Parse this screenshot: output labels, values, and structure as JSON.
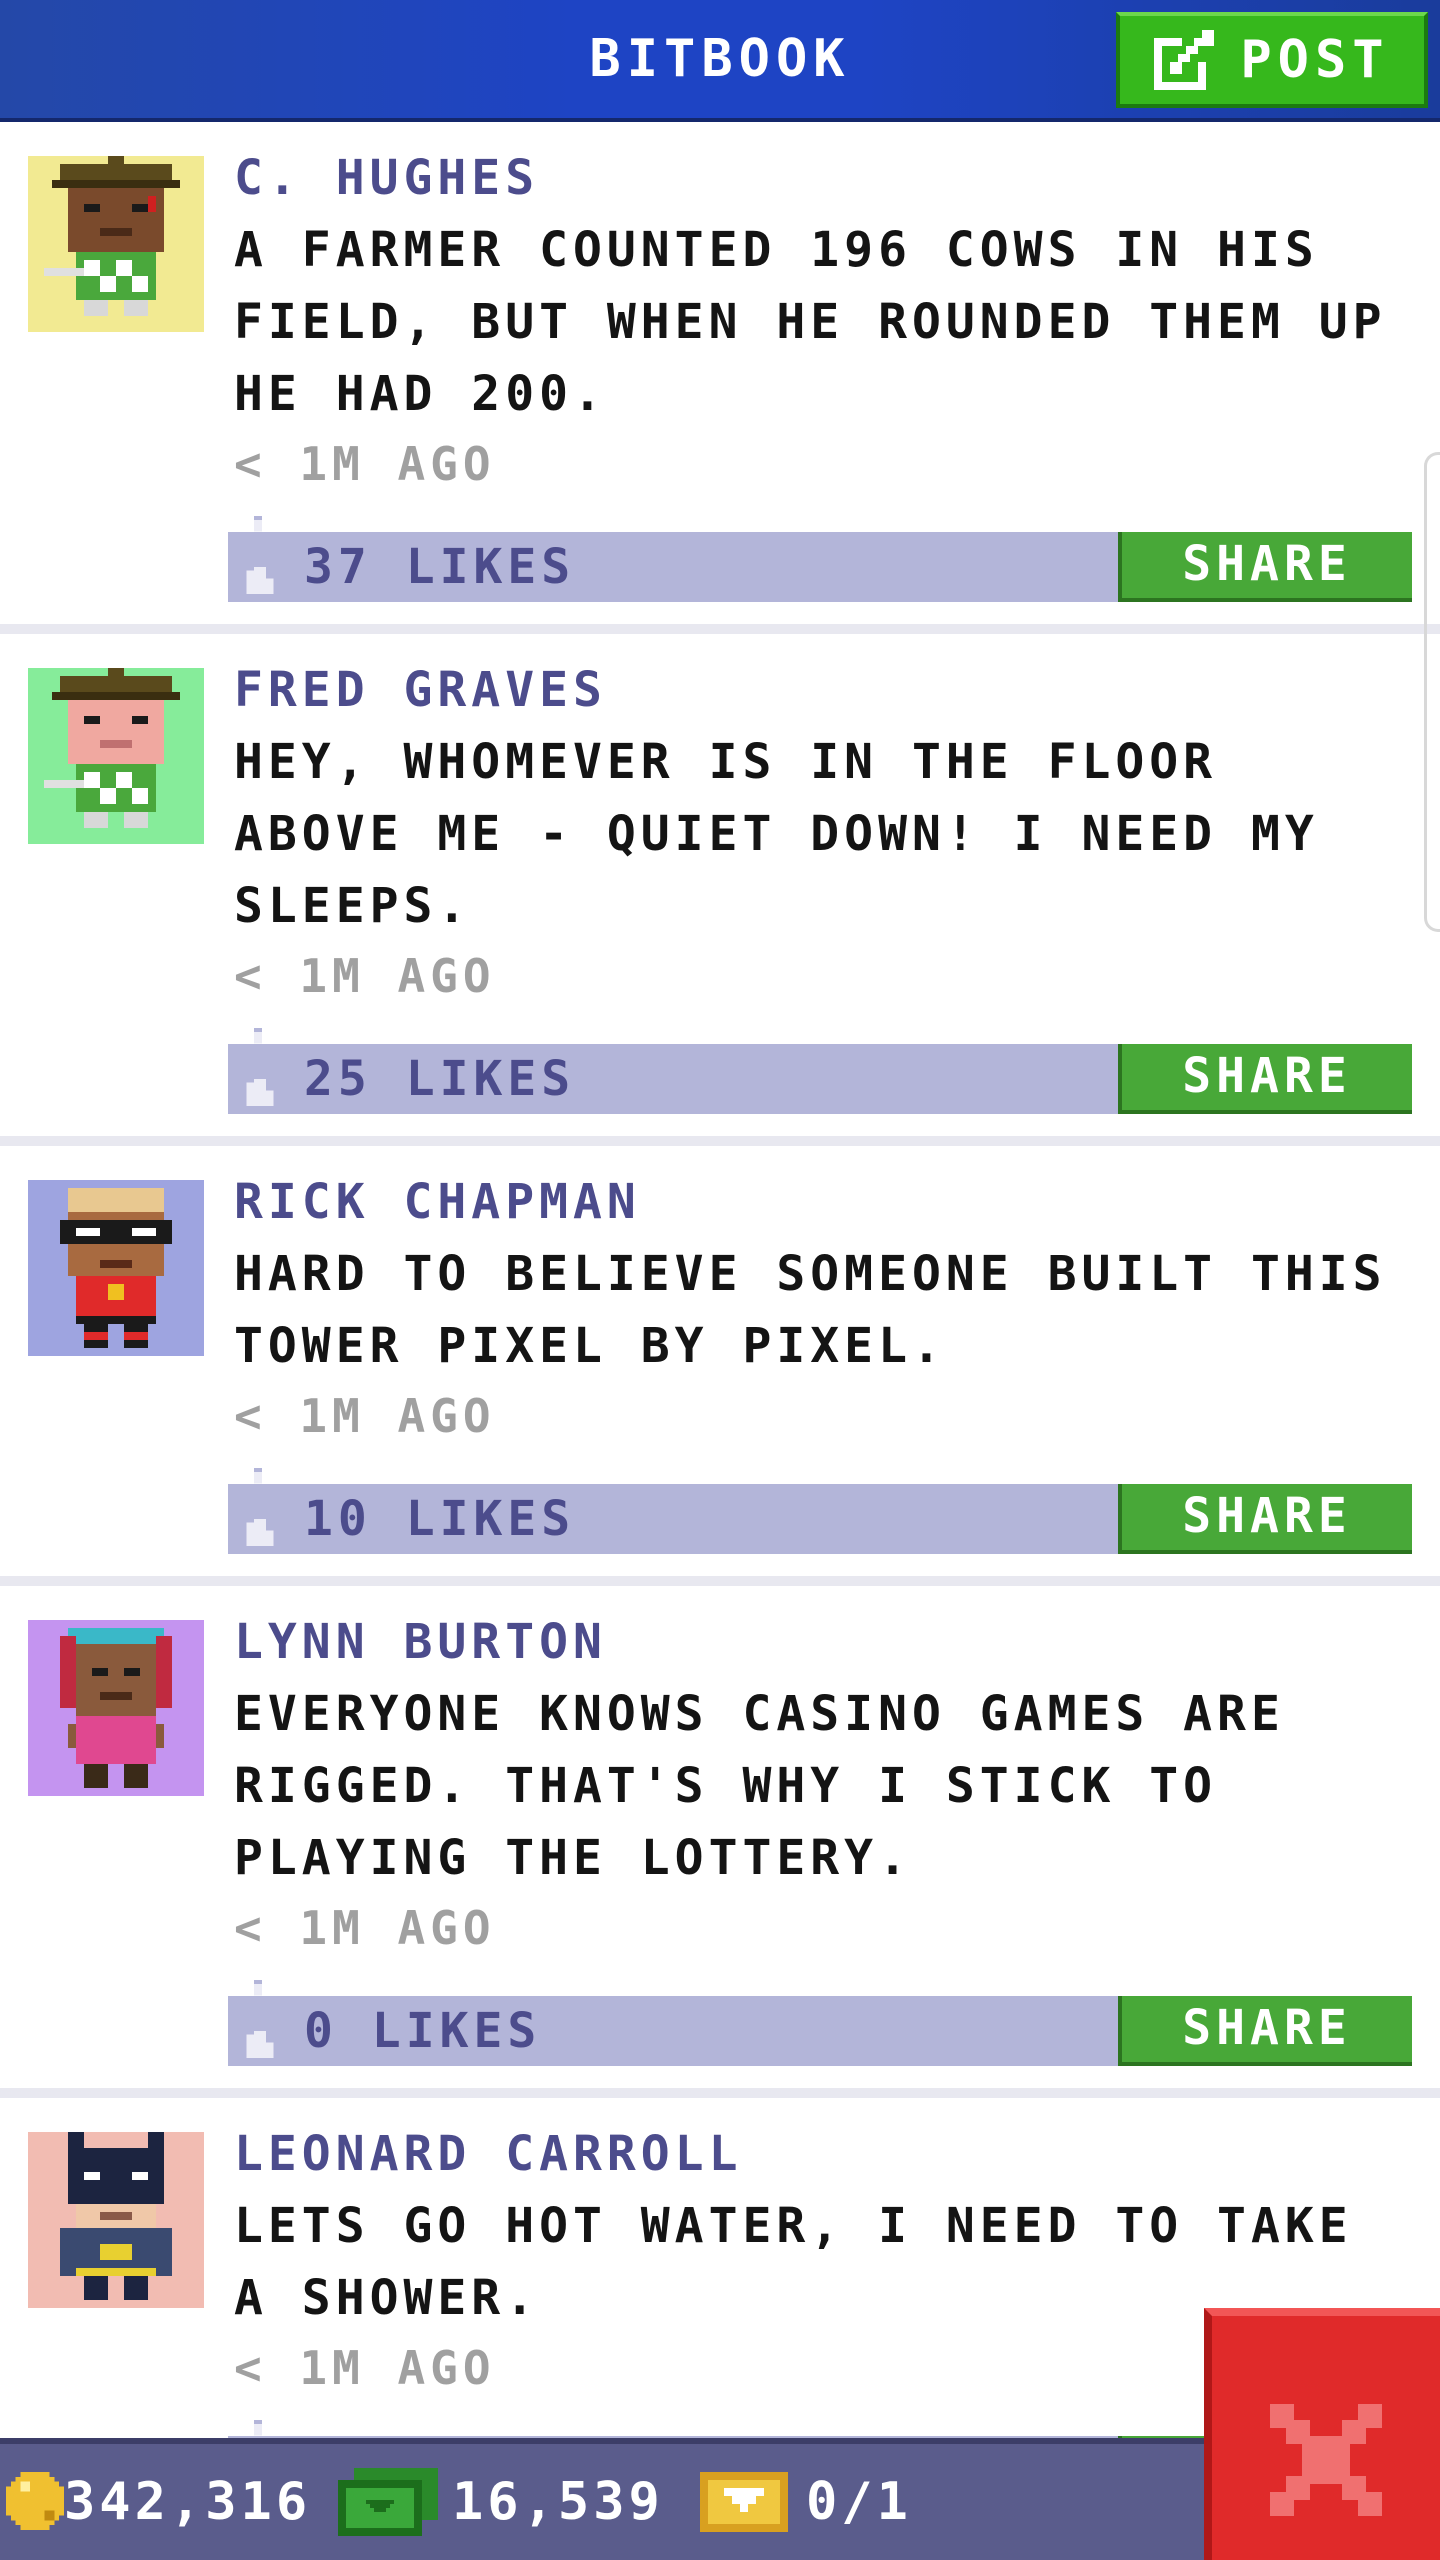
{
  "header": {
    "title": "BITBOOK",
    "post_label": "POST"
  },
  "colors": {
    "header_blue": "#1e44c4",
    "accent_green": "#36b81c",
    "like_bar": "#b3b5d9",
    "author_purple": "#4c4c8c",
    "close_red": "#e02a2a",
    "status_bar": "#5a5c8c"
  },
  "posts": [
    {
      "author": "C. HUGHES",
      "message": "A FARMER COUNTED 196 COWS IN HIS FIELD, BUT WHEN HE ROUNDED THEM UP HE HAD 200.",
      "time": "< 1M AGO",
      "likes": "37 LIKES",
      "share_label": "SHARE",
      "avatar_bg": "#f2ea92",
      "avatar_icon": "farmer-avatar-icon"
    },
    {
      "author": "FRED GRAVES",
      "message": "HEY, WHOMEVER IS IN THE FLOOR ABOVE ME - QUIET DOWN! I NEED MY SLEEPS.",
      "time": "< 1M AGO",
      "likes": "25 LIKES",
      "share_label": "SHARE",
      "avatar_bg": "#86ec9a",
      "avatar_icon": "farmer-avatar-icon"
    },
    {
      "author": "RICK CHAPMAN",
      "message": "HARD TO BELIEVE SOMEONE BUILT THIS TOWER PIXEL BY PIXEL.",
      "time": "< 1M AGO",
      "likes": "10 LIKES",
      "share_label": "SHARE",
      "avatar_bg": "#9ea4e0",
      "avatar_icon": "masked-hero-avatar-icon"
    },
    {
      "author": "LYNN BURTON",
      "message": "EVERYONE KNOWS CASINO GAMES ARE RIGGED. THAT'S WHY I STICK TO PLAYING THE LOTTERY.",
      "time": "< 1M AGO",
      "likes": "0 LIKES",
      "share_label": "SHARE",
      "avatar_bg": "#c494f0",
      "avatar_icon": "woman-avatar-icon"
    },
    {
      "author": "LEONARD CARROLL",
      "message": "LETS GO HOT WATER, I NEED TO TAKE A SHOWER.",
      "time": "< 1M AGO",
      "likes": "",
      "share_label": "",
      "avatar_bg": "#f2bcb2",
      "avatar_icon": "bat-hero-avatar-icon"
    }
  ],
  "status": {
    "coins": "342,316",
    "bux": "16,539",
    "tickets": "0/1",
    "coin_icon": "coin-icon",
    "bux_icon": "cash-icon",
    "ticket_icon": "ticket-icon"
  },
  "close_icon": "close-icon"
}
